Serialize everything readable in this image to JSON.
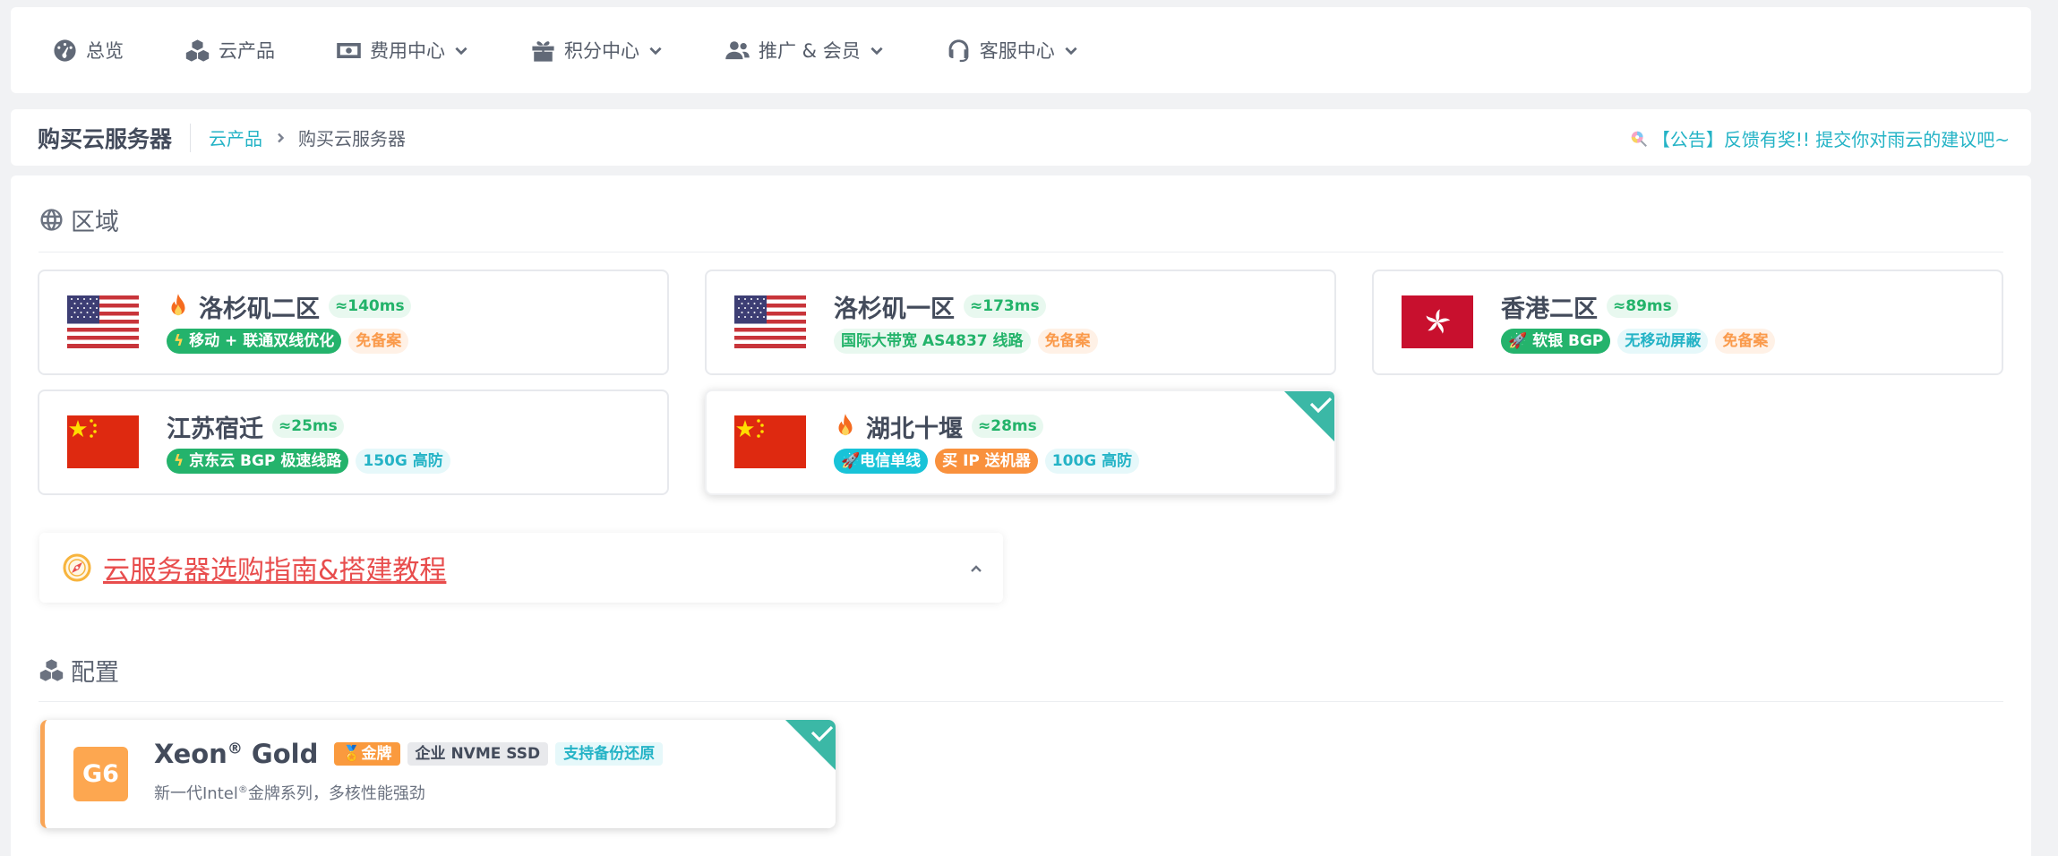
{
  "nav": {
    "items": [
      {
        "label": "总览",
        "icon": "dashboard-icon"
      },
      {
        "label": "云产品",
        "icon": "cubes-icon"
      },
      {
        "label": "费用中心",
        "icon": "money-icon"
      },
      {
        "label": "积分中心",
        "icon": "gift-icon"
      },
      {
        "label": "推广 & 会员",
        "icon": "users-icon"
      },
      {
        "label": "客服中心",
        "icon": "headset-icon"
      }
    ]
  },
  "breadcrumb": {
    "title": "购买云服务器",
    "link": "云产品",
    "current": "购买云服务器"
  },
  "announcement": "【公告】反馈有奖!! 提交你对雨云的建议吧~",
  "region_section": {
    "title": "区域",
    "cards": [
      {
        "name": "洛杉矶二区",
        "latency": "≈140ms",
        "flag": "us",
        "hot": true,
        "tags": [
          {
            "text": "移动 + 联通双线优化",
            "style": "green-solid"
          },
          {
            "text": "免备案",
            "style": "orange-soft"
          }
        ]
      },
      {
        "name": "洛杉矶一区",
        "latency": "≈173ms",
        "flag": "us",
        "hot": false,
        "tags": [
          {
            "text": "国际大带宽 AS4837 线路",
            "style": "green-soft"
          },
          {
            "text": "免备案",
            "style": "orange-soft"
          }
        ]
      },
      {
        "name": "香港二区",
        "latency": "≈89ms",
        "flag": "hk",
        "hot": false,
        "tags": [
          {
            "text": "软银 BGP",
            "style": "green-solid"
          },
          {
            "text": "无移动屏蔽",
            "style": "cyan-soft"
          },
          {
            "text": "免备案",
            "style": "orange-soft"
          }
        ]
      },
      {
        "name": "江苏宿迁",
        "latency": "≈25ms",
        "flag": "cn",
        "hot": false,
        "tags": [
          {
            "text": "京东云 BGP 极速线路",
            "style": "green-solid"
          },
          {
            "text": "150G 高防",
            "style": "cyan-soft"
          }
        ]
      },
      {
        "name": "湖北十堰",
        "latency": "≈28ms",
        "flag": "cn",
        "hot": true,
        "selected": true,
        "tags": [
          {
            "text": "电信单线",
            "style": "cyan-solid"
          },
          {
            "text": "买 IP 送机器",
            "style": "orange-solid"
          },
          {
            "text": "100G 高防",
            "style": "cyan-soft"
          }
        ]
      }
    ]
  },
  "guide": {
    "text": "云服务器选购指南&搭建教程"
  },
  "config_section": {
    "title": "配置",
    "card": {
      "badge": "G6",
      "cpu_name": "Xeon",
      "cpu_reg": "®",
      "cpu_suffix": " Gold",
      "tags": [
        {
          "text": "金牌",
          "style": "gold"
        },
        {
          "text": "企业 NVME SSD",
          "style": "gray"
        },
        {
          "text": "支持备份还原",
          "style": "cyan-soft"
        }
      ],
      "desc_prefix": "新一代Intel",
      "desc_reg": "®",
      "desc_suffix": "金牌系列，多核性能强劲",
      "selected": true
    }
  },
  "colors": {
    "accent": "#24b3c6",
    "green": "#23b36a",
    "orange": "#f9913d",
    "check": "#3bb8a6",
    "link_red": "#e84d4d"
  }
}
